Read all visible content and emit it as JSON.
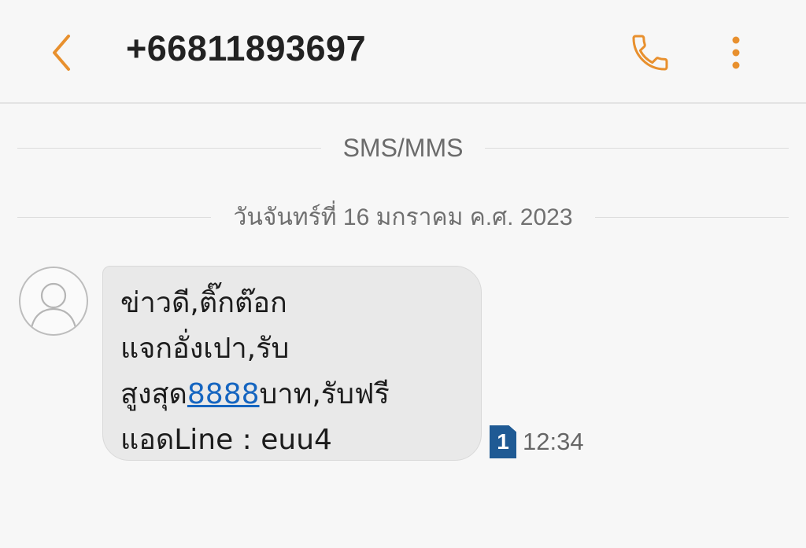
{
  "header": {
    "back_icon": "chevron-left-icon",
    "title": "+66811893697",
    "call_icon": "phone-icon",
    "more_icon": "more-vertical-icon",
    "accent_color": "#e8902e"
  },
  "thread": {
    "channel_label": "SMS/MMS",
    "date_label": "วันจันทร์ที่ 16 มกราคม ค.ศ. 2023"
  },
  "message": {
    "avatar_icon": "person-icon",
    "line1": "ข่าวดี,ติ๊กต๊อก",
    "line2": "แจกอั่งเปา,รับ",
    "line3_pre": "สูงสุด",
    "line3_link": "8888",
    "line3_post": "บาท,รับฟรี",
    "line4": "แอดLine : euu4",
    "sim_badge": "1",
    "time": "12:34",
    "link_color": "#1565c0"
  }
}
